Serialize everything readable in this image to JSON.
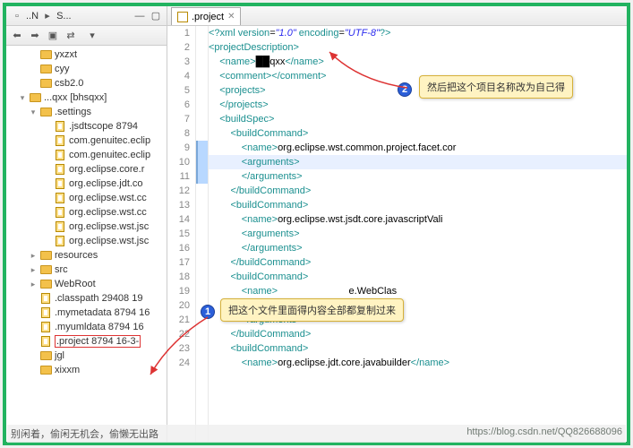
{
  "toolbar_left": {
    "nav_label": "..N",
    "search_label": "S..."
  },
  "tree": [
    {
      "indent": 12,
      "exp": "",
      "icon": "folder",
      "label": "yxzxt"
    },
    {
      "indent": 12,
      "exp": "",
      "icon": "folder",
      "label": "cyy"
    },
    {
      "indent": 12,
      "exp": "",
      "icon": "folder",
      "label": "csb2.0"
    },
    {
      "indent": 0,
      "exp": "▾",
      "icon": "folder",
      "label": "...qxx [bhsqxx]"
    },
    {
      "indent": 12,
      "exp": "▾",
      "icon": "folder",
      "label": ".settings"
    },
    {
      "indent": 28,
      "exp": "",
      "icon": "xmlfile",
      "label": ".jsdtscope 8794"
    },
    {
      "indent": 28,
      "exp": "",
      "icon": "xmlfile",
      "label": "com.genuitec.eclip"
    },
    {
      "indent": 28,
      "exp": "",
      "icon": "xmlfile",
      "label": "com.genuitec.eclip"
    },
    {
      "indent": 28,
      "exp": "",
      "icon": "xmlfile",
      "label": "org.eclipse.core.r"
    },
    {
      "indent": 28,
      "exp": "",
      "icon": "xmlfile",
      "label": "org.eclipse.jdt.co"
    },
    {
      "indent": 28,
      "exp": "",
      "icon": "xmlfile",
      "label": "org.eclipse.wst.cc"
    },
    {
      "indent": 28,
      "exp": "",
      "icon": "xmlfile",
      "label": "org.eclipse.wst.cc"
    },
    {
      "indent": 28,
      "exp": "",
      "icon": "xmlfile",
      "label": "org.eclipse.wst.jsc"
    },
    {
      "indent": 28,
      "exp": "",
      "icon": "xmlfile",
      "label": "org.eclipse.wst.jsc"
    },
    {
      "indent": 12,
      "exp": "▸",
      "icon": "folder",
      "label": "resources"
    },
    {
      "indent": 12,
      "exp": "▸",
      "icon": "folder",
      "label": "src"
    },
    {
      "indent": 12,
      "exp": "▸",
      "icon": "folder",
      "label": "WebRoot"
    },
    {
      "indent": 12,
      "exp": "",
      "icon": "xmlfile",
      "label": ".classpath 29408  19"
    },
    {
      "indent": 12,
      "exp": "",
      "icon": "xmlfile",
      "label": ".mymetadata 8794  16"
    },
    {
      "indent": 12,
      "exp": "",
      "icon": "xmlfile",
      "label": ".myumldata 8794  16"
    },
    {
      "indent": 12,
      "exp": "",
      "icon": "xmlfile",
      "label": ".project 8794  16-3-",
      "selected": true
    },
    {
      "indent": 12,
      "exp": "",
      "icon": "folder",
      "label": "jgl"
    },
    {
      "indent": 12,
      "exp": "",
      "icon": "folder",
      "label": "xixxm"
    }
  ],
  "tab": {
    "label": ".project"
  },
  "code_lines": [
    {
      "n": 1,
      "html": "<span class='pi'>&lt;?</span><span class='tag'>xml</span> <span class='tag'>version</span><span class='txt'>=</span><span class='val'>\"1.0\"</span> <span class='tag'>encoding</span><span class='txt'>=</span><span class='val'>\"UTF-8\"</span><span class='pi'>?&gt;</span>"
    },
    {
      "n": 2,
      "html": "<span class='tag'>&lt;projectDescription&gt;</span>"
    },
    {
      "n": 3,
      "html": "    <span class='tag'>&lt;name&gt;</span><span class='txt'>██qxx</span><span class='tag'>&lt;/name&gt;</span>"
    },
    {
      "n": 4,
      "html": "    <span class='tag'>&lt;comment&gt;&lt;/comment&gt;</span>"
    },
    {
      "n": 5,
      "html": "    <span class='tag'>&lt;projects&gt;</span>"
    },
    {
      "n": 6,
      "html": "    <span class='tag'>&lt;/projects&gt;</span>"
    },
    {
      "n": 7,
      "html": "    <span class='tag'>&lt;buildSpec&gt;</span>"
    },
    {
      "n": 8,
      "html": "        <span class='tag'>&lt;buildCommand&gt;</span>"
    },
    {
      "n": 9,
      "html": "            <span class='tag'>&lt;name&gt;</span><span class='txt'>org.eclipse.wst.common.project.facet.cor</span>",
      "mark": true
    },
    {
      "n": 10,
      "html": "            <span class='tag'>&lt;arguments&gt;</span>",
      "hl": true,
      "mark": true
    },
    {
      "n": 11,
      "html": "            <span class='tag'>&lt;/arguments&gt;</span>",
      "mark": true
    },
    {
      "n": 12,
      "html": "        <span class='tag'>&lt;/buildCommand&gt;</span>"
    },
    {
      "n": 13,
      "html": "        <span class='tag'>&lt;buildCommand&gt;</span>"
    },
    {
      "n": 14,
      "html": "            <span class='tag'>&lt;name&gt;</span><span class='txt'>org.eclipse.wst.jsdt.core.javascriptVali</span>"
    },
    {
      "n": 15,
      "html": "            <span class='tag'>&lt;arguments&gt;</span>"
    },
    {
      "n": 16,
      "html": "            <span class='tag'>&lt;/arguments&gt;</span>"
    },
    {
      "n": 17,
      "html": "        <span class='tag'>&lt;/buildCommand&gt;</span>"
    },
    {
      "n": 18,
      "html": "        <span class='tag'>&lt;buildCommand&gt;</span>"
    },
    {
      "n": 19,
      "html": "            <span class='tag'>&lt;name&gt;</span><span class='txt'>                          e.WebClas</span>"
    },
    {
      "n": 20,
      "html": "            <span class='tag'>&lt;arguments&gt;</span>"
    },
    {
      "n": 21,
      "html": "            <span class='tag'>&lt;/arguments&gt;</span>"
    },
    {
      "n": 22,
      "html": "        <span class='tag'>&lt;/buildCommand&gt;</span>"
    },
    {
      "n": 23,
      "html": "        <span class='tag'>&lt;buildCommand&gt;</span>"
    },
    {
      "n": 24,
      "html": "            <span class='tag'>&lt;name&gt;</span><span class='txt'>org.eclipse.jdt.core.javabuilder</span><span class='tag'>&lt;/name&gt;</span>"
    }
  ],
  "callouts": {
    "c1": {
      "num": "1",
      "text": "把这个文件里面得内容全部都复制过来"
    },
    "c2": {
      "num": "2",
      "text": "然后把这个项目名称改为自己得"
    }
  },
  "footer": {
    "caption": "别闲着，偷闲无机会，偷懒无出路",
    "watermark": "https://blog.csdn.net/QQ826688096"
  }
}
